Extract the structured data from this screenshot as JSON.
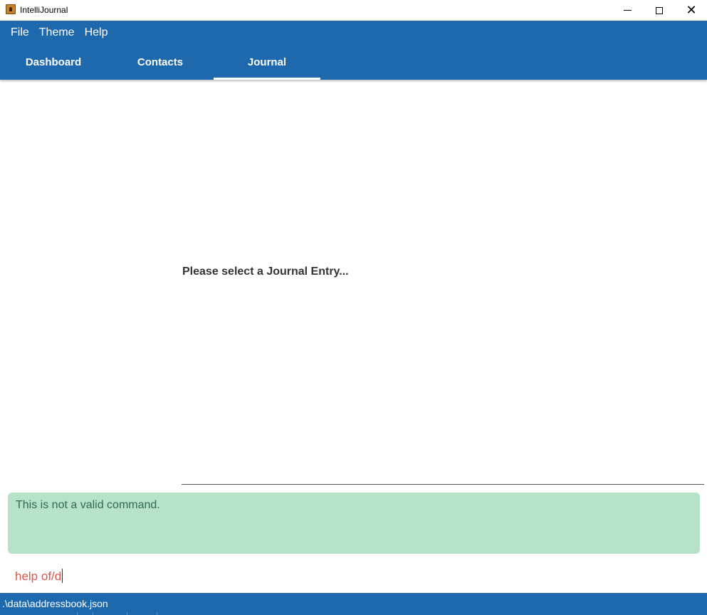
{
  "window": {
    "title": "IntelliJournal",
    "close_glyph": "✕"
  },
  "menu": {
    "items": [
      "File",
      "Theme",
      "Help"
    ]
  },
  "tabs": [
    {
      "label": "Dashboard",
      "active": false
    },
    {
      "label": "Contacts",
      "active": false
    },
    {
      "label": "Journal",
      "active": true
    }
  ],
  "journal": {
    "placeholder": "Please select a Journal Entry..."
  },
  "result": {
    "message": "This is not a valid command."
  },
  "command": {
    "value": "help of/d"
  },
  "status": {
    "file_path": ".\\data\\addressbook.json"
  },
  "colors": {
    "primary": "#1e69ad",
    "result_bg": "#b8e2c8",
    "result_text": "#2e6b57",
    "command_text": "#d9584b"
  }
}
